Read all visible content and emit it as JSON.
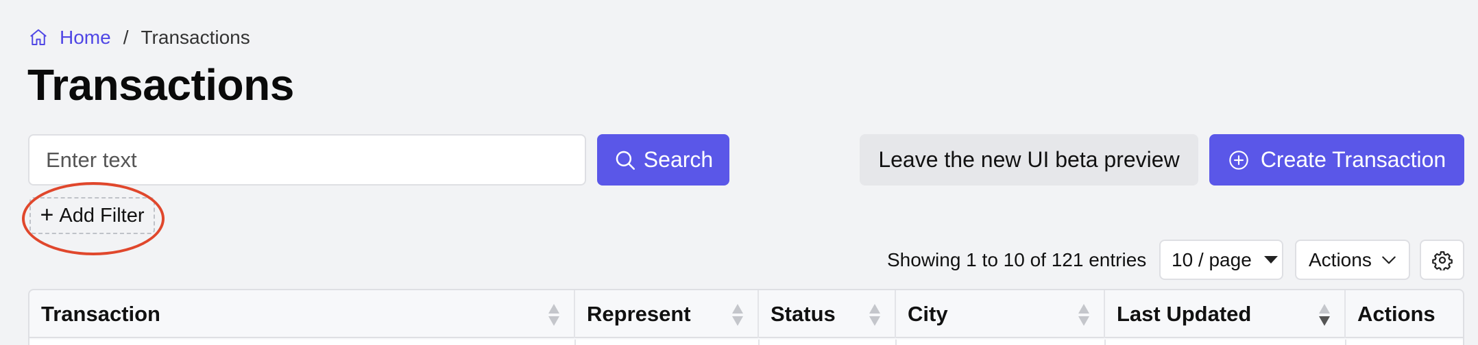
{
  "breadcrumb": {
    "home_label": "Home",
    "separator": "/",
    "current": "Transactions"
  },
  "page": {
    "title": "Transactions"
  },
  "search": {
    "placeholder": "Enter text",
    "button_label": "Search"
  },
  "header_actions": {
    "leave_beta_label": "Leave the new UI beta preview",
    "create_label": "Create Transaction"
  },
  "filters": {
    "add_filter_label": "Add Filter"
  },
  "pagination": {
    "showing_text": "Showing 1 to 10 of 121 entries",
    "page_size": "10 / page"
  },
  "toolbar": {
    "actions_label": "Actions"
  },
  "table": {
    "columns": [
      {
        "label": "Transaction",
        "sortable": true,
        "sorted": false
      },
      {
        "label": "Represent",
        "sortable": true,
        "sorted": false
      },
      {
        "label": "Status",
        "sortable": true,
        "sorted": false
      },
      {
        "label": "City",
        "sortable": true,
        "sorted": false
      },
      {
        "label": "Last Updated",
        "sortable": true,
        "sorted": "desc"
      },
      {
        "label": "Actions",
        "sortable": false,
        "sorted": false
      }
    ]
  },
  "colors": {
    "accent": "#5a57e8",
    "link": "#4f46e5",
    "highlight": "#e0472c",
    "background": "#f2f3f5"
  },
  "icons": {
    "home": "home-icon",
    "search": "search-icon",
    "create": "plus-circle-icon",
    "actions": "chevron-down-icon",
    "settings": "gear-icon",
    "sort": "sort-icon"
  }
}
